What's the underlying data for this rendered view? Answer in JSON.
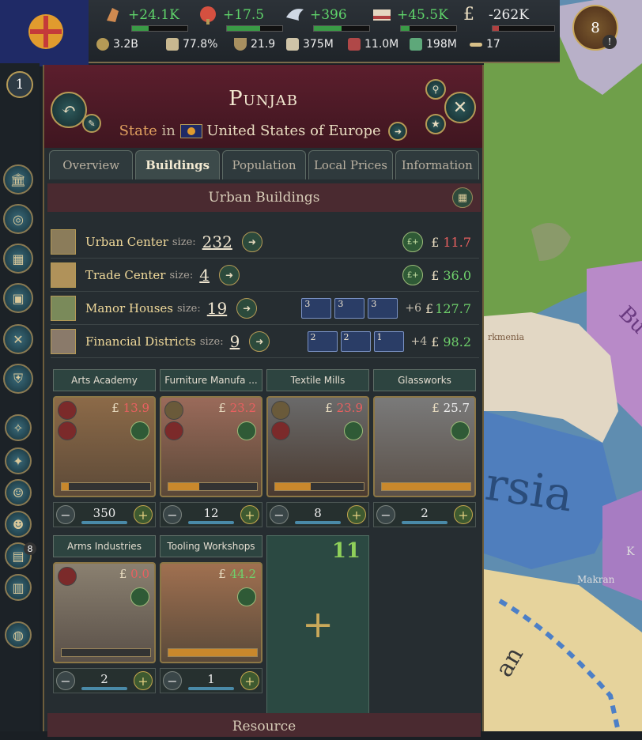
{
  "top_resources": [
    {
      "name": "prestige",
      "icon": "fist-icon",
      "value": "+24.1K",
      "color": "green"
    },
    {
      "name": "influence",
      "icon": "brain-icon",
      "value": "+17.5",
      "color": "green"
    },
    {
      "name": "diplomacy",
      "icon": "dove-icon",
      "value": "+396",
      "color": "green"
    },
    {
      "name": "bureaucracy",
      "icon": "papers-icon",
      "value": "+45.5K",
      "color": "green"
    },
    {
      "name": "treasury",
      "icon": "pound-icon",
      "value": "-262K",
      "color": "white"
    }
  ],
  "stats": [
    {
      "icon": "gdp-icon",
      "value": "3.2B"
    },
    {
      "icon": "book-icon",
      "value": "77.8%"
    },
    {
      "icon": "cup-icon",
      "value": "21.9"
    },
    {
      "icon": "people-icon",
      "value": "375M"
    },
    {
      "icon": "organ-icon",
      "value": "11.0M"
    },
    {
      "icon": "heart-icon",
      "value": "198M"
    },
    {
      "icon": "ship-icon",
      "value": "17"
    }
  ],
  "rank": "1",
  "notification_count": "8",
  "notification_badge": "!",
  "sidebar_badge": "8",
  "state": {
    "title": "Punjab",
    "label": "State",
    "in": "in",
    "country": "United States of Europe"
  },
  "tabs": [
    "Overview",
    "Buildings",
    "Population",
    "Local Prices",
    "Information"
  ],
  "active_tab": "Buildings",
  "urban_section": "Urban Buildings",
  "bottom_section": "Resource",
  "size_label": "size:",
  "currency": "£",
  "urban_buildings": [
    {
      "name": "Urban Center",
      "size": "232",
      "money": "11.7",
      "money_color": "red"
    },
    {
      "name": "Trade Center",
      "size": "4",
      "money": "36.0",
      "money_color": "ok"
    },
    {
      "name": "Manor Houses",
      "size": "19",
      "methods": [
        "3",
        "3",
        "3"
      ],
      "more": "+6",
      "money": "127.7",
      "money_color": "ok"
    },
    {
      "name": "Financial Districts",
      "size": "9",
      "methods": [
        "2",
        "2",
        "1"
      ],
      "more": "+4",
      "money": "98.2",
      "money_color": "ok"
    }
  ],
  "cards": [
    {
      "name": "Arts Academy",
      "price": "13.9",
      "price_color": "red",
      "count": "350",
      "progress": 0.08
    },
    {
      "name": "Furniture Manufa ...",
      "price": "23.2",
      "price_color": "red",
      "count": "12",
      "progress": 0.35
    },
    {
      "name": "Textile Mills",
      "price": "23.9",
      "price_color": "red",
      "count": "8",
      "progress": 0.4
    },
    {
      "name": "Glassworks",
      "price": "25.7",
      "price_color": "white",
      "count": "2",
      "progress": 1.0
    },
    {
      "name": "Arms Industries",
      "price": "0.0",
      "price_color": "red",
      "count": "2",
      "progress": 0.0
    },
    {
      "name": "Tooling Workshops",
      "price": "44.2",
      "price_color": "ok",
      "count": "1",
      "progress": 1.0
    }
  ],
  "add_card": {
    "count": "11",
    "plus": "+"
  },
  "map_labels": [
    "rsia",
    "Bu",
    "rkmenia",
    "Makran",
    "K",
    "an"
  ]
}
